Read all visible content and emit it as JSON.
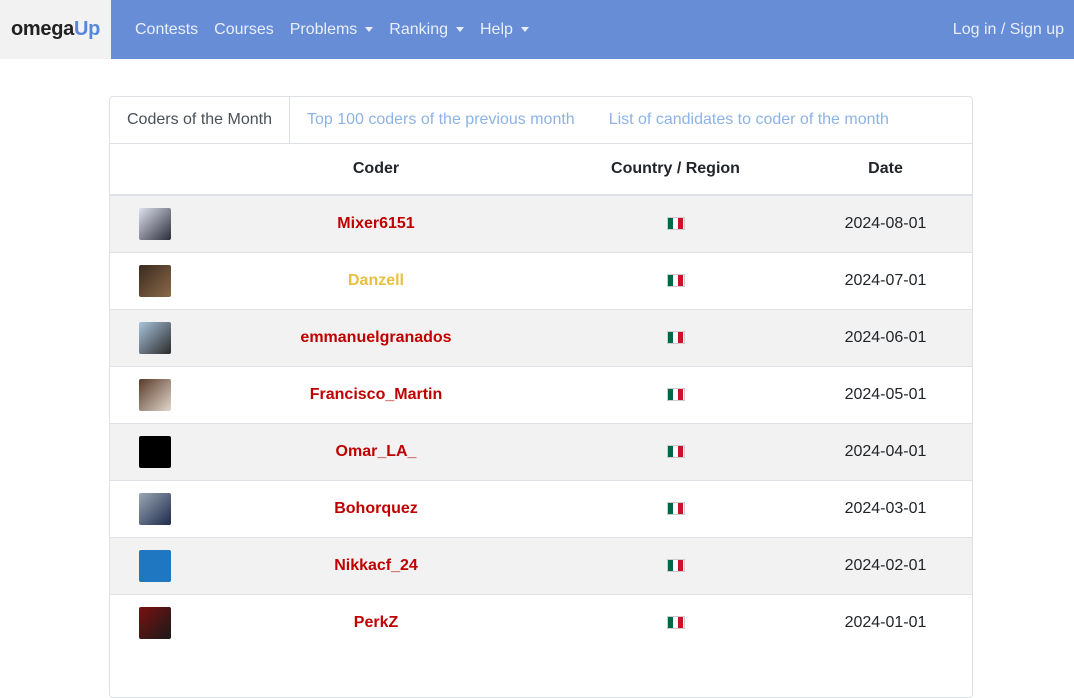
{
  "brand": {
    "name_part1": "omega",
    "name_part2": "Up"
  },
  "nav": {
    "items": [
      {
        "label": "Contests",
        "dropdown": false
      },
      {
        "label": "Courses",
        "dropdown": false
      },
      {
        "label": "Problems",
        "dropdown": true
      },
      {
        "label": "Ranking",
        "dropdown": true
      },
      {
        "label": "Help",
        "dropdown": true
      }
    ],
    "login": "Log in / Sign up"
  },
  "tabs": [
    {
      "label": "Coders of the Month",
      "active": true
    },
    {
      "label": "Top 100 coders of the previous month",
      "active": false
    },
    {
      "label": "List of candidates to coder of the month",
      "active": false
    }
  ],
  "table": {
    "headers": {
      "avatar": "",
      "coder": "Coder",
      "country": "Country / Region",
      "date": "Date"
    },
    "rows": [
      {
        "coder": "Mixer6151",
        "country": "MX",
        "date": "2024-08-01",
        "color": "#c00000"
      },
      {
        "coder": "Danzell",
        "country": "MX",
        "date": "2024-07-01",
        "color": "#e8c040"
      },
      {
        "coder": "emmanuelgranados",
        "country": "MX",
        "date": "2024-06-01",
        "color": "#c00000"
      },
      {
        "coder": "Francisco_Martin",
        "country": "MX",
        "date": "2024-05-01",
        "color": "#c00000"
      },
      {
        "coder": "Omar_LA_",
        "country": "MX",
        "date": "2024-04-01",
        "color": "#c00000"
      },
      {
        "coder": "Bohorquez",
        "country": "MX",
        "date": "2024-03-01",
        "color": "#c00000"
      },
      {
        "coder": "Nikkacf_24",
        "country": "MX",
        "date": "2024-02-01",
        "color": "#c00000"
      },
      {
        "coder": "PerkZ",
        "country": "MX",
        "date": "2024-01-01",
        "color": "#c00000"
      }
    ]
  },
  "colors": {
    "navbar": "#678dd7",
    "coder_red": "#c00000",
    "coder_gold": "#e8c040",
    "tab_inactive": "#8db3e6"
  }
}
